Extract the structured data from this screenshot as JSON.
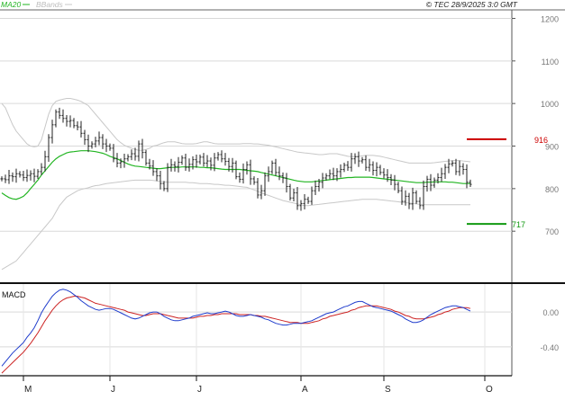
{
  "header": {
    "ma_label": "MA20",
    "bb_label": "BBands",
    "copyright": "© TEC 28/9/2025 3:0 GMT"
  },
  "colors": {
    "price_bars": "#222222",
    "ma": "#22b522",
    "bands": "#c8c8c8",
    "resistance": "#cc0000",
    "support": "#119911",
    "macd_line": "#1f3ccc",
    "signal_line": "#cc2222",
    "grid": "#d9d9d9"
  },
  "chart_data": [
    {
      "type": "ohlc",
      "yaxis_ticks": [
        "1200",
        "1100",
        "1000",
        "900",
        "800",
        "700"
      ],
      "ylim": [
        580,
        1220
      ],
      "x_ticks": [
        "M",
        "J",
        "J",
        "A",
        "S",
        "O"
      ],
      "levels": {
        "resistance": {
          "label": "916",
          "value": 916
        },
        "support": {
          "label": "717",
          "value": 717
        }
      },
      "close": [
        823,
        821,
        830,
        828,
        835,
        832,
        826,
        831,
        835,
        829,
        840,
        850,
        875,
        920,
        950,
        980,
        972,
        965,
        958,
        960,
        948,
        945,
        930,
        915,
        900,
        905,
        912,
        920,
        905,
        900,
        895,
        870,
        860,
        863,
        870,
        875,
        882,
        876,
        905,
        885,
        860,
        853,
        840,
        830,
        812,
        800,
        850,
        856,
        852,
        862,
        872,
        850,
        857,
        868,
        863,
        874,
        860,
        865,
        855,
        872,
        880,
        870,
        864,
        852,
        860,
        828,
        822,
        845,
        856,
        823,
        815,
        785,
        795,
        830,
        840,
        860,
        838,
        830,
        825,
        805,
        778,
        790,
        760,
        765,
        775,
        770,
        795,
        805,
        815,
        825,
        830,
        835,
        830,
        840,
        845,
        855,
        850,
        870,
        875,
        865,
        868,
        850,
        856,
        843,
        850,
        838,
        832,
        826,
        820,
        810,
        795,
        770,
        782,
        764,
        790,
        770,
        760,
        805,
        822,
        808,
        820,
        826,
        835,
        850,
        858,
        860,
        840,
        852,
        845,
        815,
        810
      ],
      "ma20": [
        790,
        784,
        779,
        776,
        775,
        778,
        782,
        790,
        800,
        810,
        820,
        832,
        842,
        852,
        862,
        870,
        876,
        880,
        884,
        886,
        887,
        888,
        889,
        889,
        889,
        888,
        887,
        885,
        883,
        880,
        876,
        873,
        870,
        866,
        862,
        858,
        855,
        853,
        852,
        851,
        850,
        849,
        848,
        847,
        847,
        848,
        849,
        850,
        850,
        850,
        851,
        851,
        851,
        851,
        851,
        850,
        850,
        849,
        849,
        848,
        847,
        846,
        845,
        845,
        845,
        845,
        845,
        844,
        843,
        842,
        841,
        840,
        838,
        836,
        834,
        832,
        830,
        828,
        826,
        824,
        822,
        820,
        818,
        817,
        816,
        816,
        816,
        817,
        818,
        819,
        820,
        821,
        822,
        823,
        824,
        825,
        826,
        826,
        827,
        827,
        827,
        827,
        827,
        826,
        825,
        824,
        823,
        822,
        821,
        820,
        819,
        818,
        817,
        816,
        815,
        814,
        814,
        814,
        815,
        815,
        816,
        816,
        816,
        816,
        815,
        815,
        814,
        813,
        812,
        812,
        812
      ],
      "bb_upper": [
        1000,
        990,
        970,
        950,
        935,
        925,
        915,
        905,
        900,
        898,
        900,
        915,
        945,
        975,
        995,
        1005,
        1008,
        1010,
        1012,
        1012,
        1010,
        1008,
        1005,
        1000,
        995,
        985,
        975,
        965,
        955,
        945,
        935,
        925,
        915,
        908,
        902,
        898,
        895,
        892,
        890,
        890,
        892,
        895,
        900,
        902,
        905,
        908,
        910,
        910,
        910,
        908,
        906,
        905,
        905,
        905,
        906,
        908,
        910,
        910,
        908,
        906,
        905,
        905,
        905,
        905,
        905,
        905,
        905,
        906,
        906,
        906,
        905,
        905,
        904,
        903,
        902,
        900,
        898,
        896,
        894,
        892,
        890,
        888,
        886,
        885,
        884,
        883,
        882,
        881,
        880,
        880,
        881,
        882,
        882,
        882,
        880,
        878,
        876,
        875,
        875,
        876,
        877,
        878,
        878,
        878,
        877,
        876,
        874,
        872,
        870,
        868,
        866,
        864,
        862,
        860,
        860,
        860,
        860,
        860,
        860,
        860,
        861,
        862,
        863,
        864,
        865,
        866,
        866,
        866,
        865,
        864,
        863
      ],
      "bb_lower": [
        610,
        615,
        620,
        625,
        630,
        640,
        650,
        660,
        670,
        680,
        690,
        700,
        710,
        720,
        730,
        745,
        760,
        770,
        780,
        785,
        790,
        795,
        798,
        800,
        802,
        805,
        807,
        808,
        810,
        812,
        813,
        814,
        815,
        816,
        817,
        818,
        819,
        820,
        820,
        820,
        820,
        820,
        819,
        818,
        817,
        816,
        815,
        815,
        815,
        815,
        815,
        815,
        814,
        814,
        813,
        812,
        812,
        812,
        811,
        810,
        810,
        809,
        808,
        808,
        807,
        806,
        805,
        804,
        803,
        800,
        797,
        794,
        790,
        787,
        784,
        781,
        778,
        775,
        772,
        770,
        768,
        766,
        764,
        762,
        760,
        760,
        761,
        762,
        763,
        764,
        765,
        766,
        767,
        768,
        769,
        770,
        771,
        772,
        773,
        774,
        775,
        775,
        775,
        775,
        775,
        774,
        773,
        772,
        771,
        770,
        769,
        768,
        767,
        766,
        765,
        764,
        763,
        762,
        762,
        762,
        762,
        762,
        762,
        762,
        762,
        762,
        762,
        762,
        762,
        762,
        762
      ]
    },
    {
      "type": "line",
      "title": "MACD",
      "yaxis_ticks": [
        "0.00",
        "-0.40"
      ],
      "ylim": [
        -0.72,
        0.32
      ],
      "macd": [
        -0.62,
        -0.57,
        -0.52,
        -0.47,
        -0.43,
        -0.39,
        -0.35,
        -0.29,
        -0.24,
        -0.18,
        -0.1,
        -0.01,
        0.06,
        0.12,
        0.18,
        0.22,
        0.25,
        0.26,
        0.25,
        0.23,
        0.2,
        0.17,
        0.13,
        0.1,
        0.07,
        0.05,
        0.03,
        0.02,
        0.03,
        0.04,
        0.04,
        0.03,
        0.01,
        -0.01,
        -0.03,
        -0.05,
        -0.07,
        -0.08,
        -0.07,
        -0.05,
        -0.03,
        -0.01,
        0.0,
        0.0,
        -0.02,
        -0.05,
        -0.07,
        -0.09,
        -0.1,
        -0.1,
        -0.09,
        -0.08,
        -0.07,
        -0.05,
        -0.04,
        -0.03,
        -0.02,
        -0.01,
        -0.02,
        -0.02,
        -0.01,
        0.0,
        0.01,
        0.0,
        -0.02,
        -0.04,
        -0.05,
        -0.05,
        -0.04,
        -0.03,
        -0.04,
        -0.05,
        -0.06,
        -0.08,
        -0.09,
        -0.11,
        -0.13,
        -0.14,
        -0.15,
        -0.15,
        -0.14,
        -0.13,
        -0.13,
        -0.13,
        -0.12,
        -0.11,
        -0.1,
        -0.08,
        -0.06,
        -0.04,
        -0.02,
        -0.01,
        0.0,
        0.02,
        0.04,
        0.06,
        0.07,
        0.09,
        0.11,
        0.12,
        0.12,
        0.1,
        0.08,
        0.06,
        0.05,
        0.04,
        0.03,
        0.02,
        0.01,
        -0.01,
        -0.03,
        -0.05,
        -0.08,
        -0.1,
        -0.12,
        -0.12,
        -0.11,
        -0.09,
        -0.06,
        -0.03,
        -0.01,
        0.01,
        0.03,
        0.05,
        0.06,
        0.07,
        0.07,
        0.06,
        0.05,
        0.03,
        0.01
      ],
      "signal": [
        -0.7,
        -0.66,
        -0.62,
        -0.58,
        -0.54,
        -0.5,
        -0.46,
        -0.41,
        -0.36,
        -0.3,
        -0.24,
        -0.17,
        -0.1,
        -0.04,
        0.02,
        0.07,
        0.11,
        0.14,
        0.16,
        0.17,
        0.18,
        0.18,
        0.17,
        0.16,
        0.14,
        0.12,
        0.1,
        0.09,
        0.08,
        0.07,
        0.06,
        0.05,
        0.04,
        0.03,
        0.02,
        0.0,
        -0.01,
        -0.02,
        -0.03,
        -0.04,
        -0.04,
        -0.03,
        -0.02,
        -0.02,
        -0.02,
        -0.03,
        -0.04,
        -0.05,
        -0.06,
        -0.07,
        -0.07,
        -0.07,
        -0.07,
        -0.07,
        -0.06,
        -0.05,
        -0.05,
        -0.04,
        -0.04,
        -0.03,
        -0.03,
        -0.02,
        -0.02,
        -0.02,
        -0.02,
        -0.02,
        -0.03,
        -0.03,
        -0.03,
        -0.03,
        -0.04,
        -0.04,
        -0.05,
        -0.05,
        -0.06,
        -0.07,
        -0.08,
        -0.09,
        -0.1,
        -0.11,
        -0.12,
        -0.12,
        -0.12,
        -0.13,
        -0.13,
        -0.13,
        -0.12,
        -0.11,
        -0.1,
        -0.08,
        -0.07,
        -0.05,
        -0.04,
        -0.03,
        -0.02,
        -0.01,
        0.0,
        0.02,
        0.03,
        0.05,
        0.06,
        0.07,
        0.07,
        0.07,
        0.07,
        0.06,
        0.05,
        0.04,
        0.03,
        0.01,
        0.0,
        -0.02,
        -0.04,
        -0.05,
        -0.07,
        -0.08,
        -0.08,
        -0.08,
        -0.07,
        -0.06,
        -0.05,
        -0.03,
        -0.02,
        0.0,
        0.01,
        0.03,
        0.04,
        0.05,
        0.05,
        0.05,
        0.04
      ]
    }
  ]
}
